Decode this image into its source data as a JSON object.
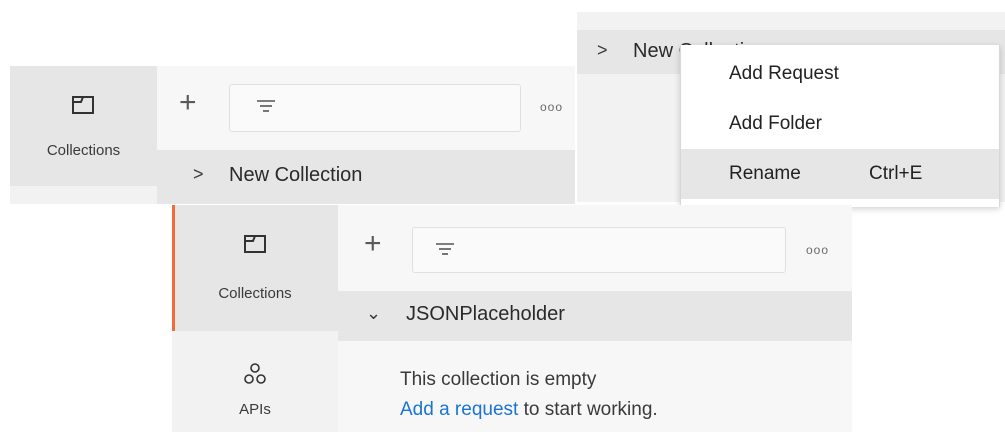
{
  "panel_top_left": {
    "nav": {
      "collections_label": "Collections"
    },
    "toolbar": {
      "more_label": "ooo"
    },
    "collection": {
      "name": "New Collection"
    }
  },
  "panel_top_right": {
    "collection": {
      "name_partial": "New Collection"
    },
    "context_menu": {
      "items": [
        {
          "label": "Add Request",
          "shortcut": ""
        },
        {
          "label": "Add Folder",
          "shortcut": ""
        },
        {
          "label": "Rename",
          "shortcut": "Ctrl+E"
        }
      ]
    }
  },
  "panel_bottom": {
    "nav": {
      "collections_label": "Collections",
      "apis_label": "APIs"
    },
    "toolbar": {
      "more_label": "ooo"
    },
    "collection": {
      "name": "JSONPlaceholder"
    },
    "empty_state": {
      "line1": "This collection is empty",
      "link": "Add a request",
      "rest": " to start working."
    }
  },
  "colors": {
    "accent": "#f26b3a",
    "link": "#1b74d3",
    "active_row": "#e6e6e6"
  },
  "icons": [
    "collections-icon",
    "plus-icon",
    "filter-icon",
    "more-icon",
    "chevron-right-icon",
    "chevron-down-icon",
    "apis-icon"
  ]
}
